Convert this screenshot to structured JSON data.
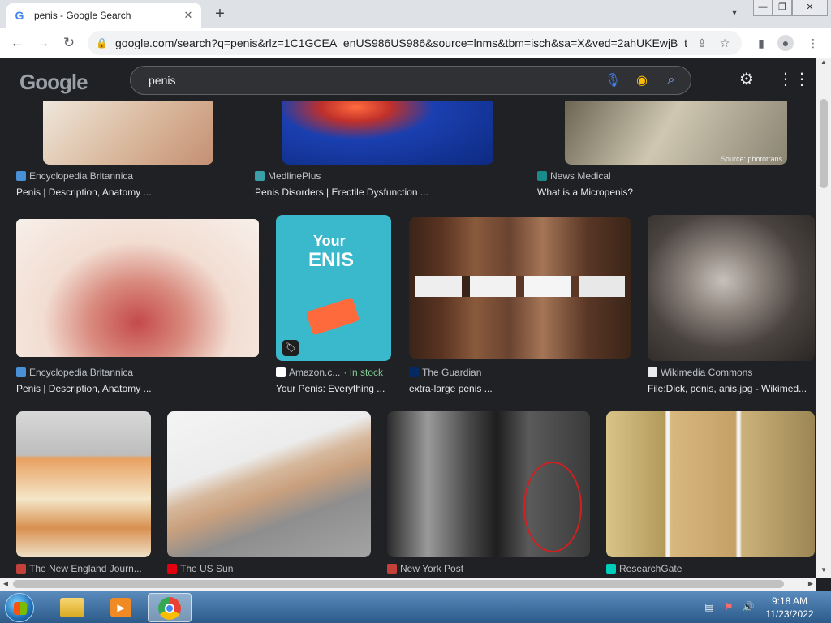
{
  "browser": {
    "tab_title": "penis - Google Search",
    "favicon": "G",
    "url": "google.com/search?q=penis&rlz=1C1GCEA_enUS986US986&source=lnms&tbm=isch&sa=X&ved=2ahUKEwjB_t..."
  },
  "google": {
    "logo_text": "Google",
    "query": "penis"
  },
  "results": [
    {
      "source": "Encyclopedia Britannica",
      "caption": "Penis | Description, Anatomy ..."
    },
    {
      "source": "MedlinePlus",
      "caption": "Penis Disorders | Erectile Dysfunction ..."
    },
    {
      "source": "News Medical",
      "caption": "What is a Micropenis?"
    },
    {
      "source": "Encyclopedia Britannica",
      "caption": "Penis | Description, Anatomy ..."
    },
    {
      "source": "Amazon.c...",
      "stock": "· In stock",
      "caption": "Your Penis: Everything ...",
      "book_title_1": "Your",
      "book_title_2": "ENIS"
    },
    {
      "source": "The Guardian",
      "caption": "extra-large penis ..."
    },
    {
      "source": "Wikimedia Commons",
      "caption": "File:Dick, penis, anis.jpg - Wikimed..."
    },
    {
      "source": "The New England Journ..."
    },
    {
      "source": "The US Sun"
    },
    {
      "source": "New York Post"
    },
    {
      "source": "ResearchGate"
    }
  ],
  "image_watermark": "Source: phototrans",
  "taskbar": {
    "time": "9:18 AM",
    "date": "11/23/2022"
  },
  "colors": {
    "bg": "#202124",
    "text": "#e8eaed",
    "muted": "#bdc1c6",
    "in_stock": "#81c995"
  }
}
